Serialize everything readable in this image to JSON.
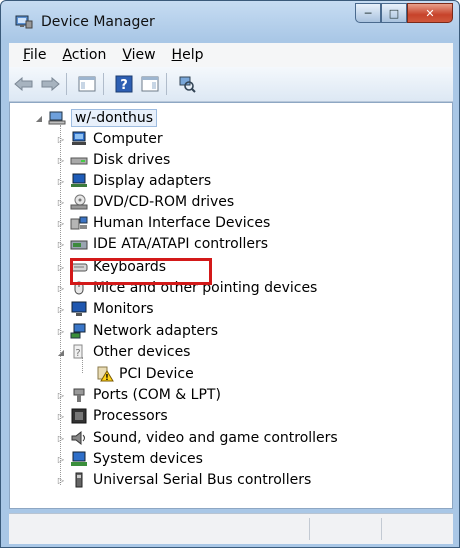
{
  "window": {
    "title": "Device Manager"
  },
  "menu": [
    {
      "label": "File",
      "accel": "F",
      "rest": "ile"
    },
    {
      "label": "Action",
      "accel": "A",
      "rest": "ction"
    },
    {
      "label": "View",
      "accel": "V",
      "rest": "iew"
    },
    {
      "label": "Help",
      "accel": "H",
      "rest": "elp"
    }
  ],
  "toolbar": {
    "icons": [
      "back-arrow-icon",
      "forward-arrow-icon",
      "show-hide-console-tree-icon",
      "help-icon",
      "properties-icon",
      "scan-hardware-icon"
    ]
  },
  "tree": {
    "root": "w/-donthus",
    "items": [
      {
        "label": "Computer",
        "icon": "computer-icon"
      },
      {
        "label": "Disk drives",
        "icon": "disk-drive-icon"
      },
      {
        "label": "Display adapters",
        "icon": "display-adapter-icon"
      },
      {
        "label": "DVD/CD-ROM drives",
        "icon": "dvd-drive-icon"
      },
      {
        "label": "Human Interface Devices",
        "icon": "hid-icon"
      },
      {
        "label": "IDE ATA/ATAPI controllers",
        "icon": "ide-controller-icon"
      },
      {
        "label": "Keyboards",
        "icon": "keyboard-icon"
      },
      {
        "label": "Mice and other pointing devices",
        "icon": "mouse-icon"
      },
      {
        "label": "Monitors",
        "icon": "monitor-icon"
      },
      {
        "label": "Network adapters",
        "icon": "network-adapter-icon"
      },
      {
        "label": "Other devices",
        "icon": "other-devices-icon",
        "expanded": true
      },
      {
        "label": "PCI Device",
        "icon": "warning-device-icon",
        "child": true
      },
      {
        "label": "Ports (COM & LPT)",
        "icon": "port-icon"
      },
      {
        "label": "Processors",
        "icon": "processor-icon"
      },
      {
        "label": "Sound, video and game controllers",
        "icon": "sound-icon"
      },
      {
        "label": "System devices",
        "icon": "system-device-icon"
      },
      {
        "label": "Universal Serial Bus controllers",
        "icon": "usb-icon"
      }
    ]
  },
  "colors": {
    "highlight": "#d31919",
    "title_bar": "#b8d1ec"
  }
}
